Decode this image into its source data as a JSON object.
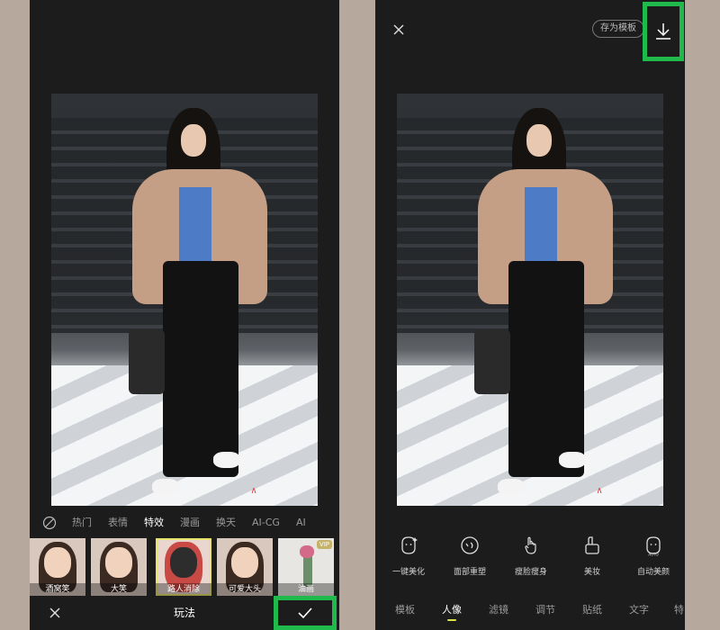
{
  "left_screen": {
    "effect_tabs": [
      "热门",
      "表情",
      "特效",
      "漫画",
      "换天",
      "AI-CG",
      "AI"
    ],
    "active_tab": "特效",
    "effects": [
      {
        "label": "酒窝笑"
      },
      {
        "label": "大笑"
      },
      {
        "label": "路人消除",
        "selected": true
      },
      {
        "label": "可爱大头"
      },
      {
        "label": "油画",
        "badge": "VIP"
      }
    ],
    "bottom_title": "玩法"
  },
  "right_screen": {
    "save_template": "存为模板",
    "tools": [
      {
        "label": "一键美化",
        "icon": "face-sparkle-icon"
      },
      {
        "label": "面部重塑",
        "icon": "face-reshape-icon"
      },
      {
        "label": "瘦脸瘦身",
        "icon": "hand-slim-icon"
      },
      {
        "label": "美妆",
        "icon": "makeup-icon"
      },
      {
        "label": "自动美颜",
        "icon": "auto-beauty-icon"
      }
    ],
    "categories": [
      "模板",
      "人像",
      "滤镜",
      "调节",
      "贴纸",
      "文字",
      "特"
    ],
    "active_category": "人像"
  },
  "colors": {
    "highlight_box": "#1fb94c",
    "phone_bg": "#1c1c1c",
    "active_underline": "#d8e04a"
  }
}
